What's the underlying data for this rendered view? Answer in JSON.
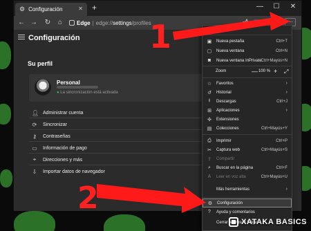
{
  "browser": {
    "tab_title": "Configuración",
    "tab_close": "✕",
    "new_tab": "+",
    "window_controls": [
      "—",
      "☐",
      "✕"
    ],
    "address_brand": "Edge",
    "address_sep": "|",
    "address_scheme": "edge://",
    "address_path": "settings",
    "address_rest": "/profiles",
    "menu_dots": "···"
  },
  "settings": {
    "title": "Configuración",
    "section_title": "Su perfil",
    "profile": {
      "name": "Personal",
      "sync_status": "La sincronización está activada"
    },
    "options": [
      {
        "label": "Administrar cuenta",
        "icon": "person-icon"
      },
      {
        "label": "Sincronizar",
        "icon": "sync-icon"
      },
      {
        "label": "Contraseñas",
        "icon": "key-icon"
      },
      {
        "label": "Información de pago",
        "icon": "card-icon"
      },
      {
        "label": "Direcciones y más",
        "icon": "location-icon"
      },
      {
        "label": "Importar datos de navegador",
        "icon": "import-icon"
      }
    ]
  },
  "menu": {
    "items": [
      {
        "label": "Nueva pestaña",
        "shortcut": "Ctrl+T"
      },
      {
        "label": "Nueva ventana",
        "shortcut": "Ctrl+N"
      },
      {
        "label": "Nueva ventana InPrivate",
        "shortcut": "Ctrl+Mayús+N"
      }
    ],
    "zoom": {
      "label": "Zoom",
      "minus": "—",
      "value": "100 %",
      "plus": "+",
      "fullscreen": "⤢"
    },
    "items2": [
      {
        "label": "Favoritos",
        "shortcut": "",
        "arrow": "›"
      },
      {
        "label": "Historial",
        "shortcut": "",
        "arrow": "›"
      },
      {
        "label": "Descargas",
        "shortcut": "Ctrl+J",
        "arrow": ""
      },
      {
        "label": "Aplicaciones",
        "shortcut": "",
        "arrow": "›"
      },
      {
        "label": "Extensiones",
        "shortcut": "",
        "arrow": ""
      },
      {
        "label": "Colecciones",
        "shortcut": "Ctrl+Mayús+Y",
        "arrow": ""
      }
    ],
    "items3": [
      {
        "label": "Imprimir",
        "shortcut": "Ctrl+P"
      },
      {
        "label": "Captura web",
        "shortcut": "Ctrl+Mayús+S"
      },
      {
        "label": "Compartir",
        "shortcut": ""
      },
      {
        "label": "Buscar en la página",
        "shortcut": "Ctrl+F"
      },
      {
        "label": "Leer en voz alta",
        "shortcut": "Ctrl+Mayús+U"
      },
      {
        "label": "Más herramientas",
        "shortcut": ""
      }
    ],
    "items4": [
      {
        "label": "Configuración"
      },
      {
        "label": "Ayuda y comentarios"
      },
      {
        "label": "Cerrar Microsoft Edge"
      }
    ]
  },
  "annotations": {
    "step1": "1",
    "step2": "2",
    "arrow_color": "#ff1a1a"
  },
  "watermark": "XATAKA BASICS",
  "colors": {
    "wallpaper_green": "#2f7d2b",
    "accent": "#2c8cff",
    "sync_green": "#3fb950"
  }
}
